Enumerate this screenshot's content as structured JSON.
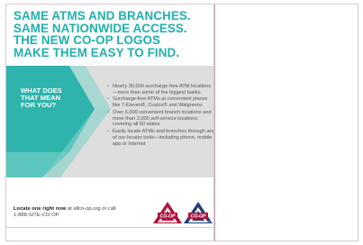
{
  "headline": {
    "line1": "SAME ATMs AND BRANCHES.",
    "line2": "SAME NATIONWIDE ACCESS.",
    "line3": "THE NEW CO-OP LOGOS",
    "line4": "MAKE THEM EASY TO FIND."
  },
  "question": {
    "line1": "WHAT DOES",
    "line2": "THAT MEAN",
    "line3": "FOR YOU?"
  },
  "bullets": [
    "Nearly 30,000 surcharge-free ATM locations—more than some of the biggest banks",
    "Surcharge-free ATMs at convenient places like 7-Eleven®, Costco® and Walgreens",
    "Over 5,000 convenient branch locations and more than 2,000 self-service locations covering all 50 states",
    "Easily locate ATMs and branches through any of our locator tools—including phone, mobile app or Internet"
  ],
  "footer": {
    "bold": "Locate one right now",
    "rest": " at allco-op.org or call",
    "phone": "1-888-SITE-CO-OP."
  },
  "logos": {
    "atm_label": "CO-OP",
    "atm_sub": "ATM",
    "branch_label": "CO-OP",
    "branch_sub": "SHARED BRANCH"
  },
  "colors": {
    "accent": "#1fb0ae",
    "logo_red": "#b0123a",
    "logo_blue": "#1c3f7a"
  }
}
